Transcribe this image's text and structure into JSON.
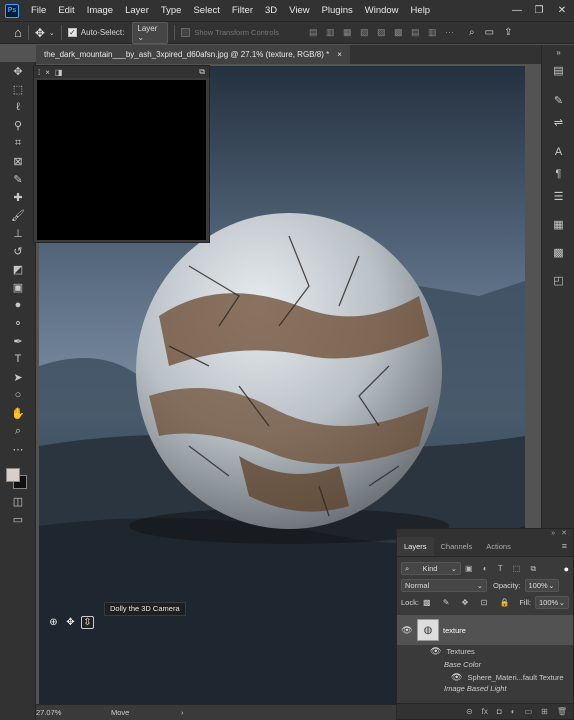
{
  "app": {
    "logo": "Ps"
  },
  "menu": [
    "File",
    "Edit",
    "Image",
    "Layer",
    "Type",
    "Select",
    "Filter",
    "3D",
    "View",
    "Plugins",
    "Window",
    "Help"
  ],
  "options": {
    "auto_select_label": "Auto-Select:",
    "auto_select_value": "Layer",
    "transform_label": "Show Transform Controls",
    "checkbox_mark": "✓"
  },
  "document": {
    "tab_title": "the_dark_mountain___by_ash_3xpired_d60afsn.jpg @ 27.1% (texture, RGB/8) *",
    "close": "×"
  },
  "navigator": {
    "close": "×"
  },
  "tooltip": {
    "text": "Dolly the 3D Camera"
  },
  "status": {
    "zoom": "27.07%",
    "tool": "Move",
    "arrow": "›"
  },
  "layers_panel": {
    "tabs": [
      "Layers",
      "Channels",
      "Actions"
    ],
    "filter_kind": "Kind",
    "blend_mode": "Normal",
    "opacity_label": "Opacity:",
    "opacity_value": "100%",
    "lock_label": "Lock:",
    "fill_label": "Fill:",
    "fill_value": "100%",
    "layer_name": "texture",
    "sub_textures": "Textures",
    "sub_base_color": "Base Color",
    "sub_material": "Sphere_Materi...fault Texture",
    "sub_ibl": "Image Based Light"
  },
  "icons": [
    "home-icon",
    "move-icon",
    "marquee-icon",
    "lasso-icon",
    "magic-wand-icon",
    "crop-icon",
    "frame-icon",
    "eyedropper-icon",
    "healing-icon",
    "brush-icon",
    "stamp-icon",
    "history-brush-icon",
    "eraser-icon",
    "gradient-icon",
    "blur-icon",
    "dodge-icon",
    "pen-icon",
    "type-icon",
    "path-select-icon",
    "ellipse-icon",
    "hand-icon",
    "zoom-icon",
    "search-icon",
    "workspace-icon",
    "share-icon",
    "eye-icon"
  ],
  "colors": {
    "accent": "#31a8ff",
    "panel": "#323232",
    "ui": "#535353"
  }
}
